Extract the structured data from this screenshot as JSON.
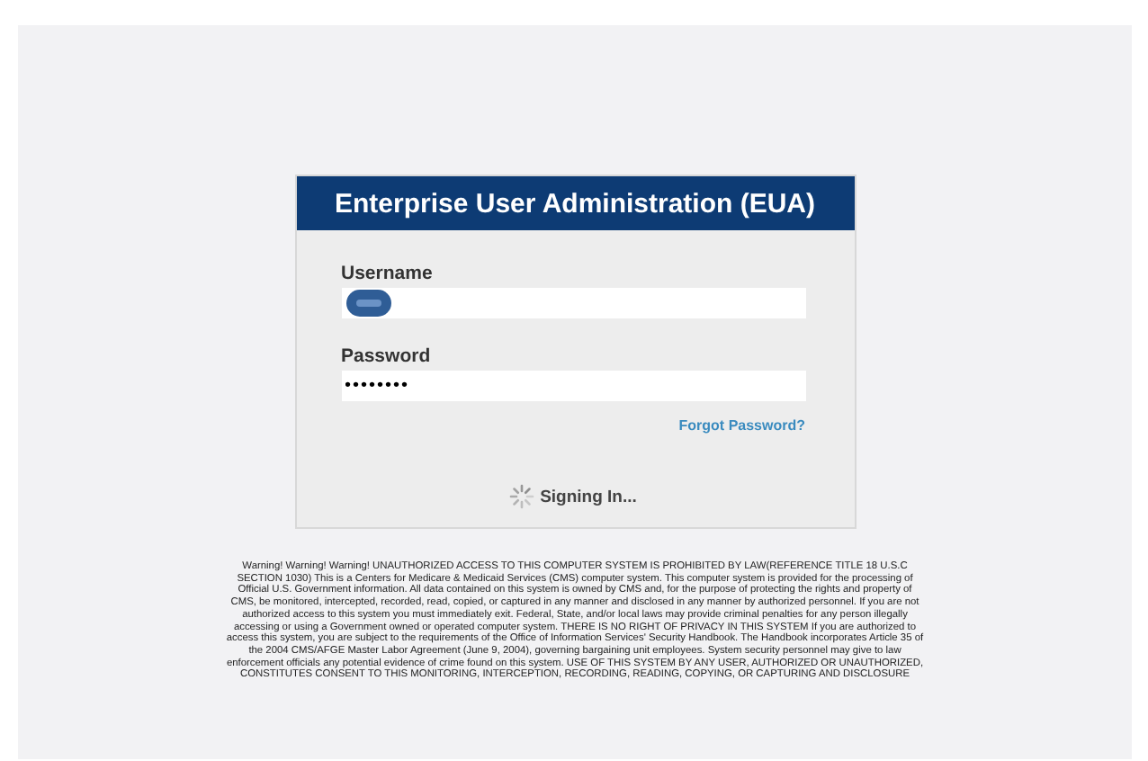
{
  "login_panel": {
    "title": "Enterprise User Administration (EUA)",
    "fields": [
      {
        "label": "Username",
        "redacted": true
      },
      {
        "label": "Password",
        "value": "••••••••"
      }
    ],
    "forgot_link": "Forgot Password?",
    "status": "Signing In..."
  },
  "warning": "Warning! Warning! Warning! UNAUTHORIZED ACCESS TO THIS COMPUTER SYSTEM IS PROHIBITED BY LAW(REFERENCE TITLE 18 U.S.C SECTION 1030) This is a Centers for Medicare & Medicaid Services (CMS) computer system. This computer system is provided for the processing of Official U.S. Government information. All data contained on this system is owned by CMS and, for the purpose of protecting the rights and property of CMS, be monitored, intercepted, recorded, read, copied, or captured in any manner and disclosed in any manner by authorized personnel. If you are not authorized access to this system you must immediately exit. Federal, State, and/or local laws may provide criminal penalties for any person illegally accessing or using a Government owned or operated computer system. THERE IS NO RIGHT OF PRIVACY IN THIS SYSTEM If you are authorized to access this system, you are subject to the requirements of the Office of Information Services' Security Handbook. The Handbook incorporates Article 35 of the 2004 CMS/AFGE Master Labor Agreement (June 9, 2004), governing bargaining unit employees. System security personnel may give to law enforcement officials any potential evidence of crime found on this system. USE OF THIS SYSTEM BY ANY USER, AUTHORIZED OR UNAUTHORIZED, CONSTITUTES CONSENT TO THIS MONITORING, INTERCEPTION, RECORDING, READING, COPYING, OR CAPTURING AND DISCLOSURE"
}
